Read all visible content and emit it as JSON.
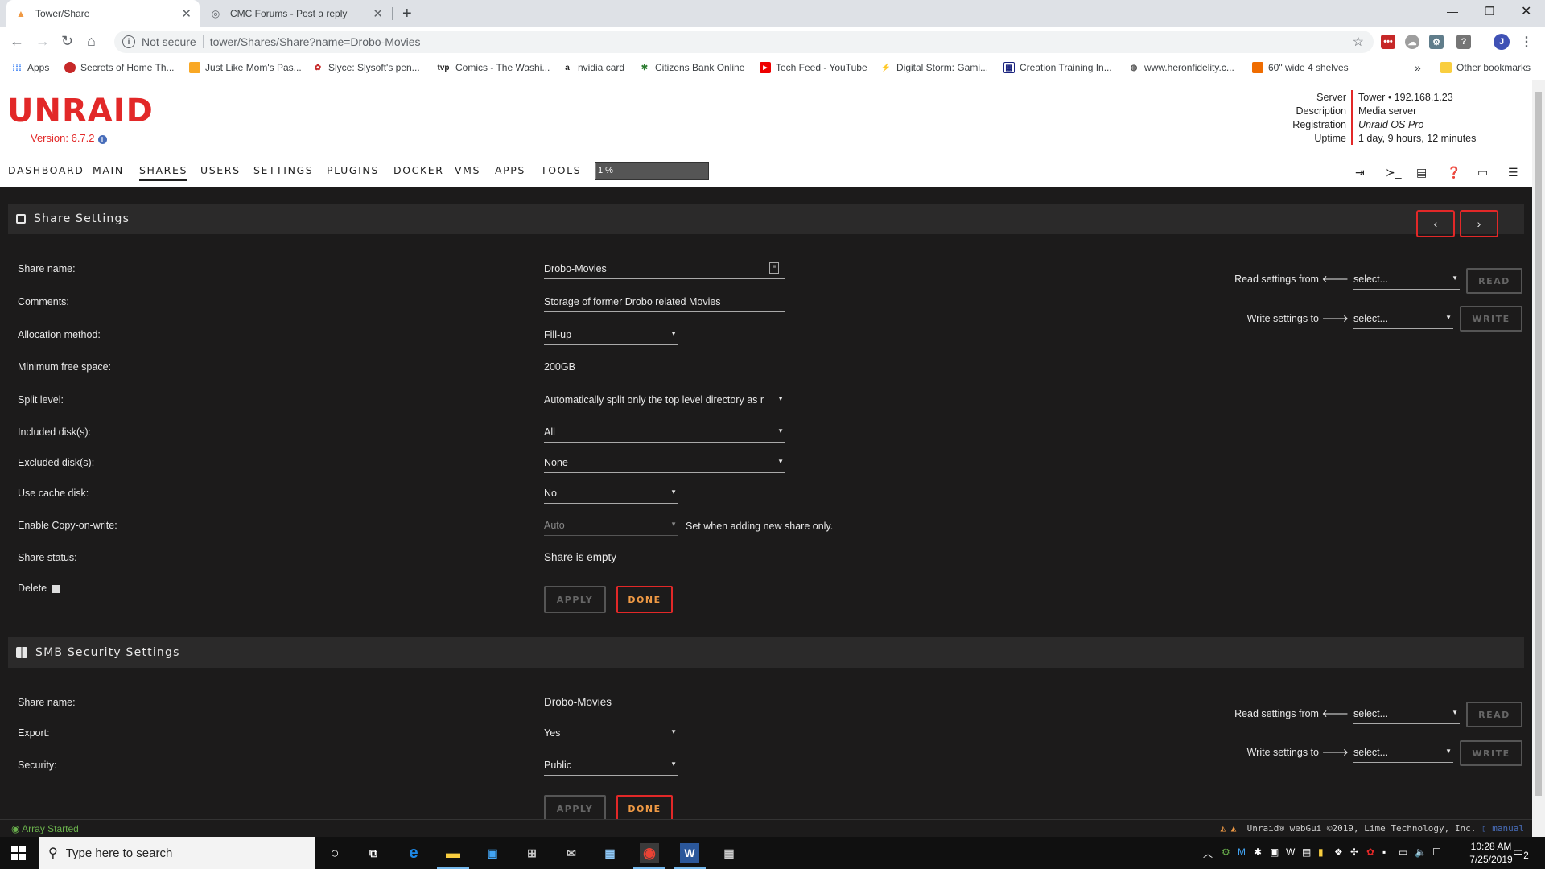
{
  "browser": {
    "tabs": [
      {
        "title": "Tower/Share",
        "active": true
      },
      {
        "title": "CMC Forums - Post a reply",
        "active": false
      }
    ],
    "security_label": "Not secure",
    "url": "tower/Shares/Share?name=Drobo-Movies",
    "profile_initial": "J",
    "bookmarks": [
      "Apps",
      "Secrets of Home Th...",
      "Just Like Mom's Pas...",
      "Slyce: Slysoft's pen...",
      "Comics - The Washi...",
      "nvidia card",
      "Citizens Bank Online",
      "Tech Feed - YouTube",
      "Digital Storm: Gami...",
      "Creation Training In...",
      "www.heronfidelity.c...",
      "60\" wide 4 shelves"
    ],
    "bookmarks_overflow": "»",
    "other_bookmarks": "Other bookmarks"
  },
  "unraid": {
    "logo": "UNRAID",
    "version": "Version: 6.7.2",
    "server_info": [
      {
        "key": "Server",
        "value": "Tower • 192.168.1.23"
      },
      {
        "key": "Description",
        "value": "Media server"
      },
      {
        "key": "Registration",
        "value": "Unraid OS Pro"
      },
      {
        "key": "Uptime",
        "value": "1 day, 9 hours, 12 minutes"
      }
    ],
    "menu": [
      "DASHBOARD",
      "MAIN",
      "SHARES",
      "USERS",
      "SETTINGS",
      "PLUGINS",
      "DOCKER",
      "VMS",
      "APPS",
      "TOOLS"
    ],
    "active_menu": "SHARES",
    "progress_label": "1 %",
    "progress_value": 0.01,
    "share_settings": {
      "title": "Share Settings",
      "fields": {
        "share_name": {
          "label": "Share name:",
          "value": "Drobo-Movies"
        },
        "comments": {
          "label": "Comments:",
          "value": "Storage of former Drobo related Movies"
        },
        "allocation": {
          "label": "Allocation method:",
          "value": "Fill-up"
        },
        "min_free": {
          "label": "Minimum free space:",
          "value": "200GB"
        },
        "split": {
          "label": "Split level:",
          "value": "Automatically split only the top level directory as r"
        },
        "included": {
          "label": "Included disk(s):",
          "value": "All"
        },
        "excluded": {
          "label": "Excluded disk(s):",
          "value": "None"
        },
        "cache": {
          "label": "Use cache disk:",
          "value": "No"
        },
        "cow": {
          "label": "Enable Copy-on-write:",
          "value": "Auto",
          "note": "Set when adding new share only."
        },
        "status": {
          "label": "Share status:",
          "value": "Share is empty"
        },
        "delete": {
          "label": "Delete"
        }
      },
      "read_label": "Read settings from",
      "write_label": "Write settings to",
      "select_placeholder": "select...",
      "read_button": "READ",
      "write_button": "WRITE",
      "apply_button": "APPLY",
      "done_button": "DONE"
    },
    "smb_settings": {
      "title": "SMB Security Settings",
      "fields": {
        "share_name": {
          "label": "Share name:",
          "value": "Drobo-Movies"
        },
        "export": {
          "label": "Export:",
          "value": "Yes"
        },
        "security": {
          "label": "Security:",
          "value": "Public"
        }
      },
      "read_label": "Read settings from",
      "write_label": "Write settings to",
      "select_placeholder": "select...",
      "read_button": "READ",
      "write_button": "WRITE",
      "apply_button": "APPLY",
      "done_button": "DONE"
    },
    "footer": {
      "status": "Array Started",
      "copyright": "Unraid® webGui ©2019, Lime Technology, Inc.",
      "manual": "manual"
    }
  },
  "taskbar": {
    "search_placeholder": "Type here to search",
    "time": "10:28 AM",
    "date": "7/25/2019",
    "notification_count": "2"
  },
  "colors": {
    "unraid_red": "#e22828",
    "button_orange": "#f09a45",
    "panel_dark": "#1c1b1b",
    "section_bar": "#2b2a2a"
  }
}
